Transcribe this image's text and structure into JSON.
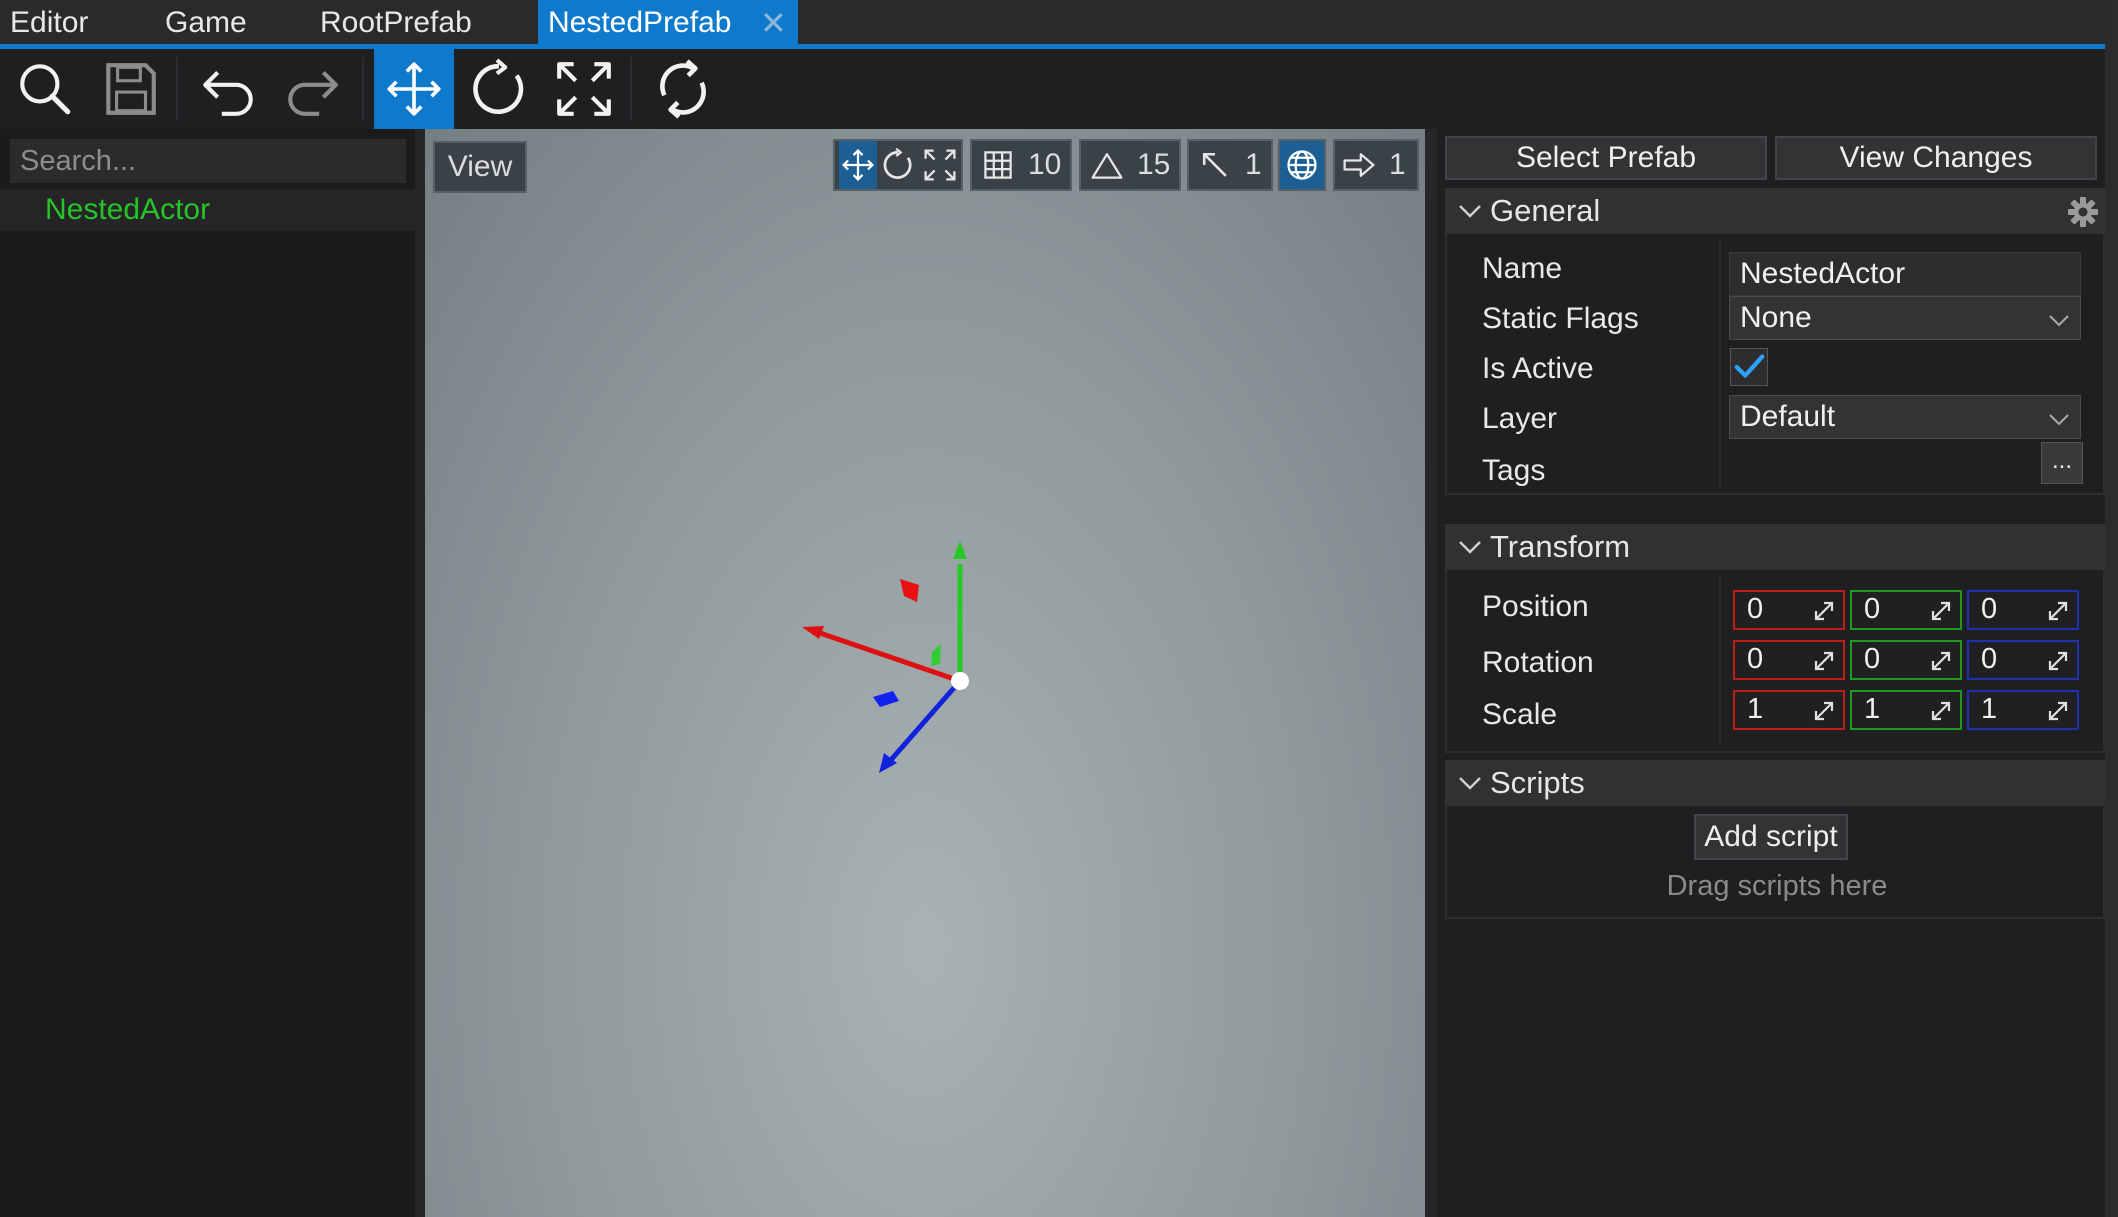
{
  "tabs": [
    {
      "label": "Editor"
    },
    {
      "label": "Game"
    },
    {
      "label": "RootPrefab"
    },
    {
      "label": "NestedPrefab",
      "active": true
    }
  ],
  "toolbar": {
    "items": [
      "search-icon",
      "save-icon",
      "undo-icon",
      "redo-icon",
      "translate-gizmo-icon",
      "rotate-gizmo-icon",
      "scale-gizmo-icon",
      "reload-icon"
    ],
    "active_item": "translate-gizmo-icon"
  },
  "hierarchy": {
    "search_placeholder": "Search...",
    "items": [
      {
        "label": "NestedActor",
        "color": "#27c427"
      }
    ]
  },
  "viewport": {
    "view_label": "View",
    "grid_snap": "10",
    "angle_snap": "15",
    "scale_snap": "1",
    "cam_speed": "1"
  },
  "properties": {
    "select_prefab_label": "Select Prefab",
    "view_changes_label": "View Changes",
    "general": {
      "title": "General",
      "name_label": "Name",
      "name_value": "NestedActor",
      "static_flags_label": "Static Flags",
      "static_flags_value": "None",
      "is_active_label": "Is Active",
      "is_active_checked": true,
      "layer_label": "Layer",
      "layer_value": "Default",
      "tags_label": "Tags",
      "tags_button": "..."
    },
    "transform": {
      "title": "Transform",
      "position_label": "Position",
      "position": [
        "0",
        "0",
        "0"
      ],
      "rotation_label": "Rotation",
      "rotation": [
        "0",
        "0",
        "0"
      ],
      "scale_label": "Scale",
      "scale": [
        "1",
        "1",
        "1"
      ]
    },
    "scripts": {
      "title": "Scripts",
      "add_script_label": "Add script",
      "drag_hint": "Drag scripts here"
    }
  },
  "colors": {
    "accent": "#0f7acc",
    "axis_x": "#c21c1c",
    "axis_y": "#1f9a1f",
    "axis_z": "#1e2fb4"
  }
}
